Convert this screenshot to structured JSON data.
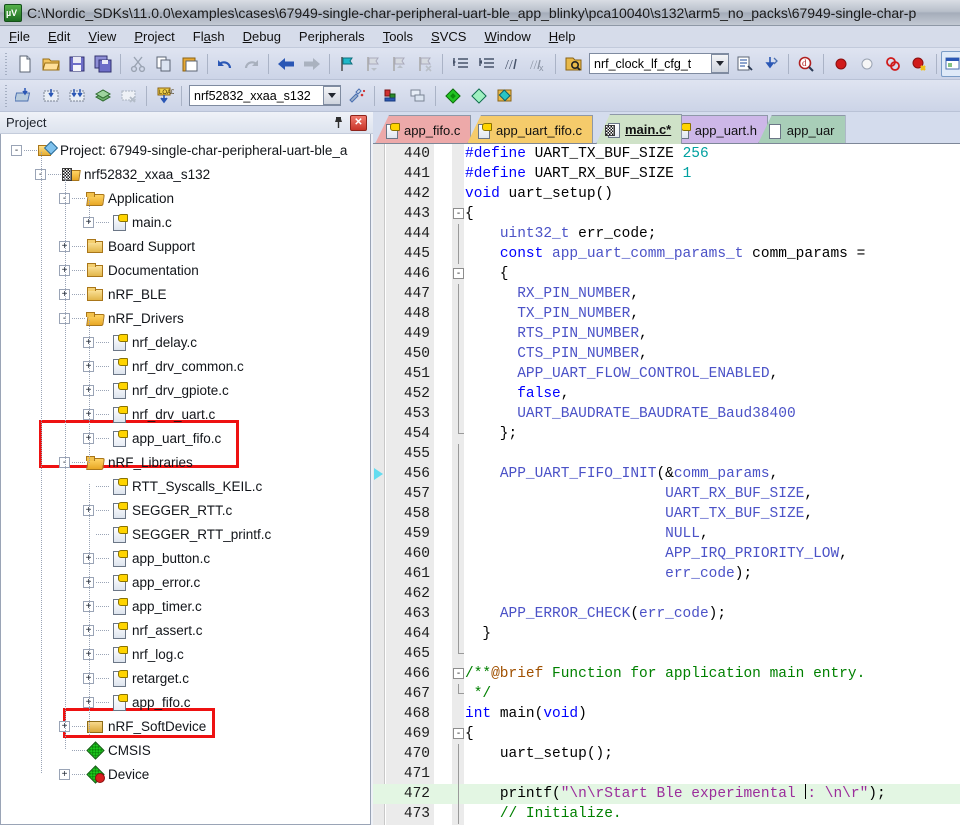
{
  "window": {
    "title": "C:\\Nordic_SDKs\\11.0.0\\examples\\cases\\67949-single-char-peripheral-uart-ble_app_blinky\\pca10040\\s132\\arm5_no_packs\\67949-single-char-p",
    "app_icon": "uvision-icon"
  },
  "menubar": {
    "items": [
      {
        "label": "File"
      },
      {
        "label": "Edit"
      },
      {
        "label": "View"
      },
      {
        "label": "Project"
      },
      {
        "label": "Flash"
      },
      {
        "label": "Debug"
      },
      {
        "label": "Peripherals"
      },
      {
        "label": "Tools"
      },
      {
        "label": "SVCS"
      },
      {
        "label": "Window"
      },
      {
        "label": "Help"
      }
    ]
  },
  "toolbar1": {
    "buttons": [
      {
        "name": "new-file-icon"
      },
      {
        "name": "open-file-icon"
      },
      {
        "name": "save-icon"
      },
      {
        "name": "save-all-icon"
      },
      {
        "name": "cut-icon"
      },
      {
        "name": "copy-icon"
      },
      {
        "name": "paste-icon"
      },
      {
        "name": "undo-icon"
      },
      {
        "name": "redo-icon"
      },
      {
        "name": "navigate-backward-icon"
      },
      {
        "name": "navigate-forward-icon"
      },
      {
        "name": "insert-bookmark-icon"
      },
      {
        "name": "previous-bookmark-icon"
      },
      {
        "name": "next-bookmark-icon"
      },
      {
        "name": "clear-bookmarks-icon"
      },
      {
        "name": "indent-icon"
      },
      {
        "name": "outdent-icon"
      },
      {
        "name": "comment-icon"
      },
      {
        "name": "uncomment-icon"
      },
      {
        "name": "find-in-files-icon"
      }
    ],
    "combo_value": "nrf_clock_lf_cfg_t",
    "buttons_right": [
      {
        "name": "browse-symbol-icon"
      },
      {
        "name": "goto-definition-icon"
      },
      {
        "name": "find-icon"
      },
      {
        "name": "insert-breakpoint-icon"
      },
      {
        "name": "disable-breakpoint-icon"
      },
      {
        "name": "kill-all-breakpoints-icon"
      },
      {
        "name": "disable-all-breakpoints-icon"
      },
      {
        "name": "manage-windows-icon"
      },
      {
        "name": "configuration-wizard-icon"
      }
    ]
  },
  "toolbar2": {
    "buttons": [
      {
        "name": "translate-icon"
      },
      {
        "name": "build-icon"
      },
      {
        "name": "rebuild-icon"
      },
      {
        "name": "batch-build-icon"
      },
      {
        "name": "stop-build-icon"
      },
      {
        "name": "download-icon"
      }
    ],
    "combo_value": "nrf52832_xxaa_s132",
    "buttons_right": [
      {
        "name": "target-options-icon"
      },
      {
        "name": "manage-project-items-icon"
      },
      {
        "name": "multi-project-icon"
      },
      {
        "name": "pack-installer-icon"
      },
      {
        "name": "manage-run-time-environment-icon"
      },
      {
        "name": "software-packs-icon"
      }
    ]
  },
  "project_panel": {
    "title": "Project",
    "pin_icon": "pin-icon",
    "close_icon": "close-icon",
    "tree": [
      {
        "label": "Project: 67949-single-char-peripheral-uart-ble_a",
        "depth": 0,
        "expander": "-",
        "icon": "proj"
      },
      {
        "label": "nrf52832_xxaa_s132",
        "depth": 1,
        "expander": "-",
        "icon": "target"
      },
      {
        "label": "Application",
        "depth": 2,
        "expander": "-",
        "icon": "folder-open"
      },
      {
        "label": "main.c",
        "depth": 3,
        "expander": "+",
        "icon": "cfile-chk"
      },
      {
        "label": "Board Support",
        "depth": 2,
        "expander": "+",
        "icon": "folder-closed"
      },
      {
        "label": "Documentation",
        "depth": 2,
        "expander": "+",
        "icon": "folder-closed"
      },
      {
        "label": "nRF_BLE",
        "depth": 2,
        "expander": "+",
        "icon": "folder-closed"
      },
      {
        "label": "nRF_Drivers",
        "depth": 2,
        "expander": "-",
        "icon": "folder-open"
      },
      {
        "label": "nrf_delay.c",
        "depth": 3,
        "expander": "+",
        "icon": "cfile"
      },
      {
        "label": "nrf_drv_common.c",
        "depth": 3,
        "expander": "+",
        "icon": "cfile"
      },
      {
        "label": "nrf_drv_gpiote.c",
        "depth": 3,
        "expander": "+",
        "icon": "cfile"
      },
      {
        "label": "nrf_drv_uart.c",
        "depth": 3,
        "expander": "+",
        "icon": "cfile"
      },
      {
        "label": "app_uart_fifo.c",
        "depth": 3,
        "expander": "+",
        "icon": "cfile-plain"
      },
      {
        "label": "nRF_Libraries",
        "depth": 2,
        "expander": "-",
        "icon": "folder-open"
      },
      {
        "label": "RTT_Syscalls_KEIL.c",
        "depth": 3,
        "expander": "",
        "icon": "cfile"
      },
      {
        "label": "SEGGER_RTT.c",
        "depth": 3,
        "expander": "+",
        "icon": "cfile"
      },
      {
        "label": "SEGGER_RTT_printf.c",
        "depth": 3,
        "expander": "",
        "icon": "cfile"
      },
      {
        "label": "app_button.c",
        "depth": 3,
        "expander": "+",
        "icon": "cfile"
      },
      {
        "label": "app_error.c",
        "depth": 3,
        "expander": "+",
        "icon": "cfile"
      },
      {
        "label": "app_timer.c",
        "depth": 3,
        "expander": "+",
        "icon": "cfile"
      },
      {
        "label": "nrf_assert.c",
        "depth": 3,
        "expander": "+",
        "icon": "cfile"
      },
      {
        "label": "nrf_log.c",
        "depth": 3,
        "expander": "+",
        "icon": "cfile"
      },
      {
        "label": "retarget.c",
        "depth": 3,
        "expander": "+",
        "icon": "cfile"
      },
      {
        "label": "app_fifo.c",
        "depth": 3,
        "expander": "+",
        "icon": "cfile-plain"
      },
      {
        "label": "nRF_SoftDevice",
        "depth": 2,
        "expander": "+",
        "icon": "block"
      },
      {
        "label": "CMSIS",
        "depth": 2,
        "expander": "",
        "icon": "diamond"
      },
      {
        "label": "Device",
        "depth": 2,
        "expander": "+",
        "icon": "diamond-x"
      }
    ],
    "highlight_color": "#ee1111"
  },
  "editor": {
    "tabs": [
      {
        "label": "app_fifo.c",
        "color": "#eda9a9",
        "icon": "key-file-icon",
        "active": false
      },
      {
        "label": "app_uart_fifo.c",
        "color": "#f5cb6b",
        "icon": "key-file-icon",
        "active": false
      },
      {
        "label": "main.c*",
        "color": "#cfe2c8",
        "icon": "checkered-file-icon",
        "active": true
      },
      {
        "label": "app_uart.h",
        "color": "#cdb7e8",
        "icon": "key-file-icon",
        "active": false
      },
      {
        "label": "app_uar",
        "color": "#a8ceb8",
        "icon": "plain-file-icon",
        "active": false
      }
    ],
    "current_line": 472,
    "marker_line": 456,
    "lines": [
      {
        "n": 440,
        "fold": "",
        "tokens": [
          {
            "t": "#define ",
            "c": "mac"
          },
          {
            "t": "UART_TX_BUF_SIZE ",
            "c": "fn"
          },
          {
            "t": "256",
            "c": "num"
          }
        ]
      },
      {
        "n": 441,
        "fold": "",
        "tokens": [
          {
            "t": "#define ",
            "c": "mac"
          },
          {
            "t": "UART_RX_BUF_SIZE ",
            "c": "fn"
          },
          {
            "t": "1",
            "c": "num"
          }
        ]
      },
      {
        "n": 442,
        "fold": "",
        "tokens": [
          {
            "t": "void ",
            "c": "kw"
          },
          {
            "t": "uart_setup()",
            "c": "fn"
          }
        ]
      },
      {
        "n": 443,
        "fold": "start",
        "tokens": [
          {
            "t": "{",
            "c": "fn"
          }
        ]
      },
      {
        "n": 444,
        "fold": "bar",
        "tokens": [
          {
            "t": "    ",
            "c": "fn"
          },
          {
            "t": "uint32_t ",
            "c": "cons"
          },
          {
            "t": "err_code;",
            "c": "fn"
          }
        ]
      },
      {
        "n": 445,
        "fold": "bar",
        "tokens": [
          {
            "t": "    ",
            "c": "fn"
          },
          {
            "t": "const ",
            "c": "kw"
          },
          {
            "t": "app_uart_comm_params_t ",
            "c": "cons"
          },
          {
            "t": "comm_params =",
            "c": "fn"
          }
        ]
      },
      {
        "n": 446,
        "fold": "start",
        "tokens": [
          {
            "t": "    {",
            "c": "fn"
          }
        ]
      },
      {
        "n": 447,
        "fold": "bar",
        "tokens": [
          {
            "t": "      ",
            "c": "fn"
          },
          {
            "t": "RX_PIN_NUMBER",
            "c": "cons"
          },
          {
            "t": ",",
            "c": "fn"
          }
        ]
      },
      {
        "n": 448,
        "fold": "bar",
        "tokens": [
          {
            "t": "      ",
            "c": "fn"
          },
          {
            "t": "TX_PIN_NUMBER",
            "c": "cons"
          },
          {
            "t": ",",
            "c": "fn"
          }
        ]
      },
      {
        "n": 449,
        "fold": "bar",
        "tokens": [
          {
            "t": "      ",
            "c": "fn"
          },
          {
            "t": "RTS_PIN_NUMBER",
            "c": "cons"
          },
          {
            "t": ",",
            "c": "fn"
          }
        ]
      },
      {
        "n": 450,
        "fold": "bar",
        "tokens": [
          {
            "t": "      ",
            "c": "fn"
          },
          {
            "t": "CTS_PIN_NUMBER",
            "c": "cons"
          },
          {
            "t": ",",
            "c": "fn"
          }
        ]
      },
      {
        "n": 451,
        "fold": "bar",
        "tokens": [
          {
            "t": "      ",
            "c": "fn"
          },
          {
            "t": "APP_UART_FLOW_CONTROL_ENABLED",
            "c": "cons"
          },
          {
            "t": ",",
            "c": "fn"
          }
        ]
      },
      {
        "n": 452,
        "fold": "bar",
        "tokens": [
          {
            "t": "      ",
            "c": "fn"
          },
          {
            "t": "false",
            "c": "kw"
          },
          {
            "t": ",",
            "c": "fn"
          }
        ]
      },
      {
        "n": 453,
        "fold": "bar",
        "tokens": [
          {
            "t": "      ",
            "c": "fn"
          },
          {
            "t": "UART_BAUDRATE_BAUDRATE_Baud38400",
            "c": "cons"
          }
        ]
      },
      {
        "n": 454,
        "fold": "end",
        "tokens": [
          {
            "t": "    };",
            "c": "fn"
          }
        ]
      },
      {
        "n": 455,
        "fold": "bar",
        "tokens": [
          {
            "t": "",
            "c": "fn"
          }
        ]
      },
      {
        "n": 456,
        "fold": "bar",
        "tokens": [
          {
            "t": "    ",
            "c": "fn"
          },
          {
            "t": "APP_UART_FIFO_INIT",
            "c": "cons"
          },
          {
            "t": "(&",
            "c": "fn"
          },
          {
            "t": "comm_params",
            "c": "cons"
          },
          {
            "t": ",",
            "c": "fn"
          }
        ]
      },
      {
        "n": 457,
        "fold": "bar",
        "tokens": [
          {
            "t": "                       ",
            "c": "fn"
          },
          {
            "t": "UART_RX_BUF_SIZE",
            "c": "cons"
          },
          {
            "t": ",",
            "c": "fn"
          }
        ]
      },
      {
        "n": 458,
        "fold": "bar",
        "tokens": [
          {
            "t": "                       ",
            "c": "fn"
          },
          {
            "t": "UART_TX_BUF_SIZE",
            "c": "cons"
          },
          {
            "t": ",",
            "c": "fn"
          }
        ]
      },
      {
        "n": 459,
        "fold": "bar",
        "tokens": [
          {
            "t": "                       ",
            "c": "fn"
          },
          {
            "t": "NULL",
            "c": "cons"
          },
          {
            "t": ",",
            "c": "fn"
          }
        ]
      },
      {
        "n": 460,
        "fold": "bar",
        "tokens": [
          {
            "t": "                       ",
            "c": "fn"
          },
          {
            "t": "APP_IRQ_PRIORITY_LOW",
            "c": "cons"
          },
          {
            "t": ",",
            "c": "fn"
          }
        ]
      },
      {
        "n": 461,
        "fold": "bar",
        "tokens": [
          {
            "t": "                       ",
            "c": "fn"
          },
          {
            "t": "err_code",
            "c": "cons"
          },
          {
            "t": ");",
            "c": "fn"
          }
        ]
      },
      {
        "n": 462,
        "fold": "bar",
        "tokens": [
          {
            "t": "",
            "c": "fn"
          }
        ]
      },
      {
        "n": 463,
        "fold": "bar",
        "tokens": [
          {
            "t": "    ",
            "c": "fn"
          },
          {
            "t": "APP_ERROR_CHECK",
            "c": "cons"
          },
          {
            "t": "(",
            "c": "fn"
          },
          {
            "t": "err_code",
            "c": "cons"
          },
          {
            "t": ");",
            "c": "fn"
          }
        ]
      },
      {
        "n": 464,
        "fold": "bar",
        "tokens": [
          {
            "t": "  }",
            "c": "fn"
          }
        ]
      },
      {
        "n": 465,
        "fold": "end",
        "tokens": [
          {
            "t": "",
            "c": "fn"
          }
        ]
      },
      {
        "n": 466,
        "fold": "start",
        "tokens": [
          {
            "t": "/**",
            "c": "com"
          },
          {
            "t": "@brief",
            "c": "brief"
          },
          {
            "t": " Function for application main entry.",
            "c": "com"
          }
        ]
      },
      {
        "n": 467,
        "fold": "end",
        "tokens": [
          {
            "t": " */",
            "c": "com"
          }
        ]
      },
      {
        "n": 468,
        "fold": "",
        "tokens": [
          {
            "t": "int ",
            "c": "kw"
          },
          {
            "t": "main(",
            "c": "fn"
          },
          {
            "t": "void",
            "c": "kw"
          },
          {
            "t": ")",
            "c": "fn"
          }
        ]
      },
      {
        "n": 469,
        "fold": "start",
        "tokens": [
          {
            "t": "{",
            "c": "fn"
          }
        ]
      },
      {
        "n": 470,
        "fold": "bar",
        "tokens": [
          {
            "t": "    ",
            "c": "fn"
          },
          {
            "t": "uart_setup();",
            "c": "fn"
          }
        ]
      },
      {
        "n": 471,
        "fold": "bar",
        "tokens": [
          {
            "t": "",
            "c": "fn"
          }
        ]
      },
      {
        "n": 472,
        "fold": "bar",
        "tokens": [
          {
            "t": "    ",
            "c": "fn"
          },
          {
            "t": "printf(",
            "c": "fn"
          },
          {
            "t": "\"\\n\\rStart Ble experimental ",
            "c": "str"
          },
          {
            "t": "CARET",
            "c": "caret"
          },
          {
            "t": ": \\n\\r\"",
            "c": "str"
          },
          {
            "t": ");",
            "c": "fn"
          }
        ]
      },
      {
        "n": 473,
        "fold": "bar",
        "tokens": [
          {
            "t": "    ",
            "c": "fn"
          },
          {
            "t": "// Initialize.",
            "c": "com"
          }
        ]
      }
    ]
  }
}
